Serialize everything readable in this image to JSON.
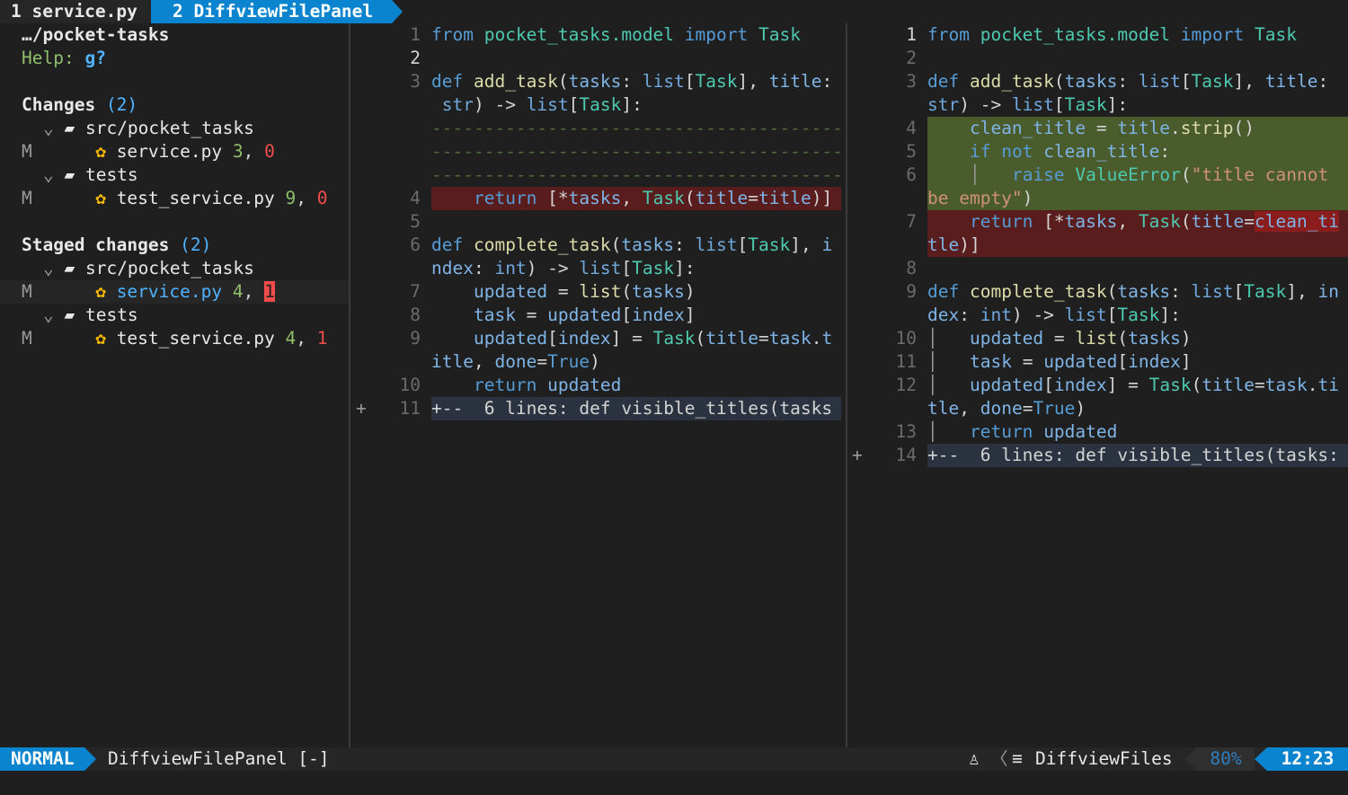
{
  "tabs": [
    {
      "label": "1 service.py"
    },
    {
      "label": "2 DiffviewFilePanel"
    }
  ],
  "panel": {
    "root": "…/pocket-tasks",
    "help_label": "Help:",
    "help_key": "g?",
    "changes_title": "Changes",
    "changes_count": "(2)",
    "staged_title": "Staged changes",
    "staged_count": "(2)",
    "dir_src": "src/pocket_tasks",
    "dir_tests": "tests",
    "status_m": "M",
    "file_service": "service.py",
    "file_test": "test_service.py",
    "changes_service_add": "3",
    "changes_service_del": "0",
    "changes_test_add": "9",
    "changes_test_del": "0",
    "staged_service_add": "4",
    "staged_service_del": "1",
    "staged_test_add": "4",
    "staged_test_del": "1"
  },
  "left_pane": {
    "line_numbers": [
      "1",
      "2",
      "3",
      "",
      "",
      "",
      "",
      "4",
      "5",
      "6",
      "",
      "7",
      "8",
      "9",
      "",
      "10",
      "11"
    ],
    "fold_marker": "+",
    "fold_text": "+--  6 lines: def visible_titles(tasks"
  },
  "right_pane": {
    "line_numbers": [
      "1",
      "2",
      "3",
      "",
      "4",
      "5",
      "6",
      "",
      "7",
      "",
      "8",
      "9",
      "",
      "10",
      "11",
      "12",
      "",
      "13",
      "14"
    ],
    "fold_marker": "+",
    "fold_text": "+--  6 lines: def visible_titles(tasks:"
  },
  "status": {
    "mode": "NORMAL",
    "filename": "DiffviewFilePanel [-]",
    "right_name": "DiffviewFiles",
    "percent": "80%",
    "time": "12:23"
  },
  "colors": {
    "accent": "#0a84cf",
    "delete_bg": "#5a1d1d",
    "add_bg": "#4b5c2c",
    "background": "#1f1f1f"
  }
}
